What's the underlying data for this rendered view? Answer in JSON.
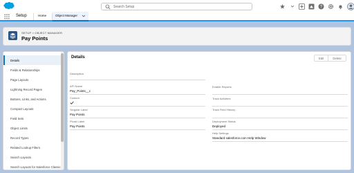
{
  "header": {
    "search_placeholder": "Search Setup",
    "icons": [
      "grid-star-icon",
      "add-icon",
      "help-icon",
      "gear-icon",
      "bell-icon",
      "avatar"
    ]
  },
  "nav": {
    "app_name": "Setup",
    "tabs": [
      {
        "label": "Home"
      },
      {
        "label": "Object Manager",
        "active": true
      }
    ]
  },
  "page_header": {
    "breadcrumb": "SETUP > OBJECT MANAGER",
    "title": "Pay Points"
  },
  "sidebar": {
    "items": [
      {
        "label": "Details",
        "active": true
      },
      {
        "label": "Fields & Relationships"
      },
      {
        "label": "Page Layouts"
      },
      {
        "label": "Lightning Record Pages"
      },
      {
        "label": "Buttons, Links, and Actions"
      },
      {
        "label": "Compact Layouts"
      },
      {
        "label": "Field Sets"
      },
      {
        "label": "Object Limits"
      },
      {
        "label": "Record Types"
      },
      {
        "label": "Related Lookup Filters"
      },
      {
        "label": "Search Layouts"
      },
      {
        "label": "Search Layouts for Salesforce Classic"
      }
    ]
  },
  "details": {
    "title": "Details",
    "edit_label": "Edit",
    "delete_label": "Delete",
    "description_label": "Description",
    "api_name_label": "API Name",
    "api_name_value": "Pay_Points__c",
    "custom_label": "Custom",
    "singular_label_label": "Singular Label",
    "singular_label_value": "Pay Points",
    "plural_label_label": "Plural Label",
    "plural_label_value": "Pay Points",
    "enable_reports_label": "Enable Reports",
    "track_activities_label": "Track Activities",
    "track_field_history_label": "Track Field History",
    "deployment_status_label": "Deployment Status",
    "deployment_status_value": "Deployed",
    "help_settings_label": "Help Settings",
    "help_settings_value": "Standard salesforce.com Help Window"
  },
  "colors": {
    "brand": "#0176d3",
    "background": "#b0c4df",
    "object_icon": "#2a5585"
  }
}
